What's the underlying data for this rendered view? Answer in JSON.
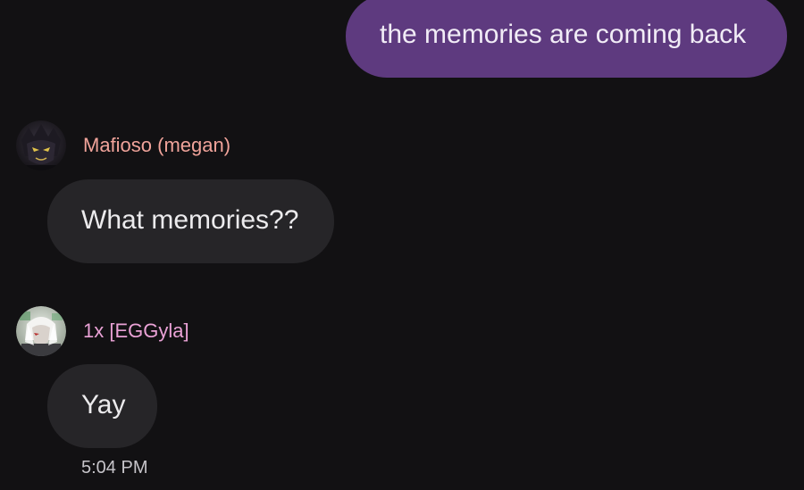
{
  "messages": {
    "outgoing": {
      "text": "the memories are coming back"
    },
    "incoming": [
      {
        "sender": "Mafioso (megan)",
        "text": "What memories??",
        "sender_color": "#f0a39a",
        "avatar": "dark-masked-character-avatar"
      },
      {
        "sender": "1x [EGGyla]",
        "text": "Yay",
        "sender_color": "#eaa2d6",
        "avatar": "white-haired-character-avatar"
      }
    ],
    "timestamp": "5:04 PM"
  },
  "colors": {
    "background": "#121113",
    "outgoing_bubble": "#5e3a7f",
    "incoming_bubble": "#262528",
    "text": "#ecebed"
  }
}
